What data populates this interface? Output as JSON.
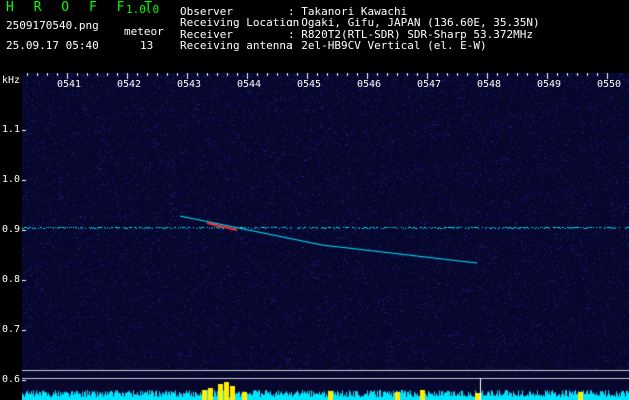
{
  "header": {
    "app_title": "H R O F F T",
    "app_version": "1.0.0",
    "filename": "2509170540.png",
    "datetime": "25.09.17 05:40",
    "meteor_label": "meteor",
    "meteor_count": "13"
  },
  "info": [
    {
      "label": "Observer",
      "value": ": Takanori Kawachi"
    },
    {
      "label": "Receiving Location",
      "value": ": Ogaki, Gifu, JAPAN (136.60E, 35.35N)"
    },
    {
      "label": "Receiver",
      "value": ": R820T2(RTL-SDR) SDR-Sharp 53.372MHz"
    },
    {
      "label": "Receiving antenna",
      "value": ": 2el-HB9CV Vertical (el. E-W)"
    }
  ],
  "axes": {
    "y_unit": "kHz",
    "y_ticks": [
      "1.1",
      "1.0",
      "0.9",
      "0.8",
      "0.7",
      "0.6"
    ],
    "x_ticks": [
      "0541",
      "0542",
      "0543",
      "0544",
      "0545",
      "0546",
      "0547",
      "0548",
      "0549",
      "0550"
    ]
  },
  "colors": {
    "background": "#000000",
    "spectrogram_bg": "#07072e",
    "text_white": "#ffffff",
    "text_green": "#00ff00",
    "signal_cyan": "#00e5ff",
    "meteor_red": "#ff3030",
    "bar_yellow": "#ffee00"
  }
}
